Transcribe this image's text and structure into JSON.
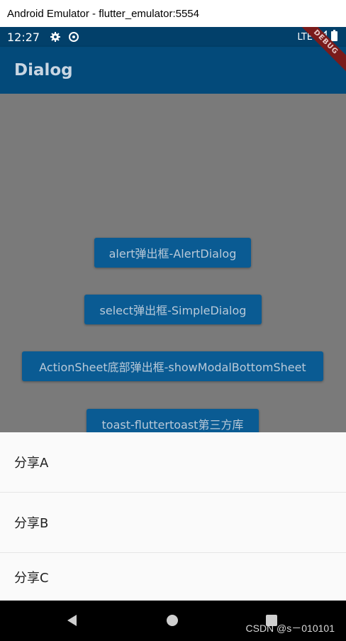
{
  "window": {
    "title": "Android Emulator - flutter_emulator:5554"
  },
  "statusbar": {
    "time": "12:27",
    "network": "LTE",
    "icons": [
      "gear-icon",
      "sync-icon",
      "signal-icon",
      "battery-icon"
    ]
  },
  "appbar": {
    "title": "Dialog",
    "debug_banner": "DEBUG"
  },
  "buttons": [
    {
      "label": "alert弹出框-AlertDialog"
    },
    {
      "label": "select弹出框-SimpleDialog"
    },
    {
      "label": "ActionSheet底部弹出框-showModalBottomSheet"
    },
    {
      "label": "toast-fluttertoast第三方库"
    }
  ],
  "bottom_sheet": {
    "items": [
      {
        "label": "分享A"
      },
      {
        "label": "分享B"
      },
      {
        "label": "分享C"
      }
    ]
  },
  "navbar": {
    "icons": [
      "back-icon",
      "home-icon",
      "recents-icon"
    ]
  },
  "watermark": "CSDN @s－010101",
  "colors": {
    "statusbar": "#02406a",
    "appbar": "#034a7a",
    "button": "#0a5b93",
    "scrim": "#7a7a7a",
    "sheet": "#fafafa"
  }
}
